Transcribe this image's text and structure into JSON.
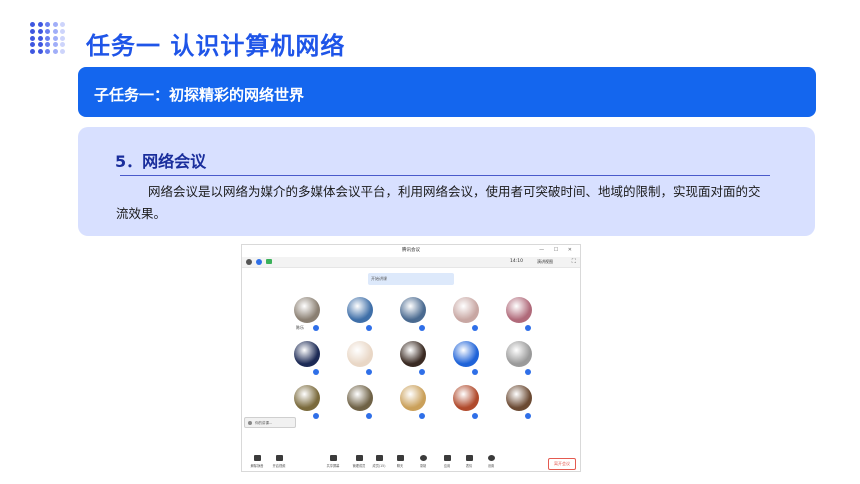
{
  "page": {
    "title": "任务一  认识计算机网络",
    "subtask": "子任务一：初探精彩的网络世界",
    "section_heading": "5．网络会议",
    "paragraph": "网络会议是以网络为媒介的多媒体会议平台，利用网络会议，使用者可突破时间、地域的限制，实现面对面的交流效果。"
  },
  "colors": {
    "accent": "#1466ee",
    "title": "#1f55e8",
    "card": "#d8e0ff"
  },
  "meeting": {
    "window_title": "腾讯会议",
    "window_buttons": "— ☐ ✕",
    "time": "14:10",
    "view_label": "演讲视图",
    "banner": "开始讲课",
    "host_label": "陈乐",
    "popup": "你的讲课...",
    "bottom_left": [
      {
        "label": "解除静音"
      },
      {
        "label": "开启视频"
      }
    ],
    "bottom_center": [
      {
        "label": "共享屏幕"
      },
      {
        "label": "管理成员"
      },
      {
        "label": "成员(15)"
      },
      {
        "label": "聊天"
      },
      {
        "label": "录制"
      },
      {
        "label": "应用"
      },
      {
        "label": "表情"
      },
      {
        "label": "设置"
      }
    ],
    "end_button": "离开会议"
  }
}
